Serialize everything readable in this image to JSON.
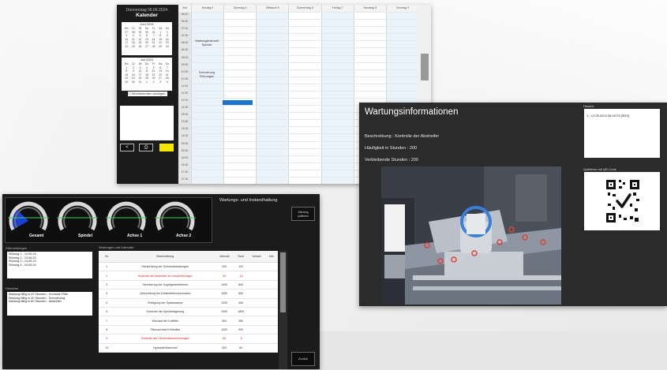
{
  "calendar": {
    "weekday_line": "Donnerstag 06.06.2024",
    "title": "Kalender",
    "months": [
      {
        "name": "Juni 2024",
        "days": [
          "Mo",
          "Di",
          "Mi",
          "Do",
          "Fr",
          "Sa",
          "So",
          "27",
          "28",
          "29",
          "30",
          "31",
          "1",
          "2",
          "3",
          "4",
          "5",
          "6",
          "7",
          "8",
          "9",
          "10",
          "11",
          "12",
          "13",
          "14",
          "15",
          "16",
          "17",
          "18",
          "19",
          "20",
          "21",
          "22",
          "23",
          "24",
          "25",
          "26",
          "27",
          "28",
          "29",
          "30"
        ]
      },
      {
        "name": "Juli 2024",
        "days": [
          "Mo",
          "Di",
          "Mi",
          "Do",
          "Fr",
          "Sa",
          "So",
          "1",
          "2",
          "3",
          "4",
          "5",
          "6",
          "7",
          "8",
          "9",
          "10",
          "11",
          "12",
          "13",
          "14",
          "15",
          "16",
          "17",
          "18",
          "19",
          "20",
          "21",
          "22",
          "23",
          "24",
          "25",
          "26",
          "27",
          "28",
          "29",
          "30",
          "31",
          "1",
          "2",
          "3",
          "4"
        ]
      }
    ],
    "checkbox_label": "Wochenenden anzeigen",
    "buttons": [
      "<",
      "⎙",
      ""
    ],
    "time_header": "Zeit",
    "day_headers": [
      "Montag 3",
      "Dienstag 4",
      "Mittwoch 5",
      "Donnerstag 6",
      "Freitag 7",
      "Samstag 8",
      "Sonntag 9"
    ],
    "times": [
      "06:00",
      "06:30",
      "07:00",
      "07:30",
      "08:00",
      "08:30",
      "09:00",
      "09:30",
      "10:00",
      "10:30",
      "11:00",
      "11:30",
      "12:00",
      "12:30",
      "13:00",
      "13:30",
      "14:00",
      "14:30",
      "15:00",
      "15:30",
      "16:00",
      "16:30",
      "17:00",
      "17:30"
    ],
    "events": [
      "Wartungsintervall Spindel",
      "Schmierung Führungen"
    ]
  },
  "maintenance": {
    "title": "Wartungsinformationen",
    "lines": [
      "Beschreibung : Kontrolle der Abstreifer",
      "Häufigkeit in Stunden : 200",
      "Verbleibende Stunden : 200"
    ],
    "history_label": "Historie",
    "history_entry": "1 - 12.06.2024 08:40:23 [SDS]",
    "qr_label": "Quittieren mit QR-Code"
  },
  "counters": {
    "gauges": [
      "Gesamt",
      "Spindel",
      "Achse 1",
      "Achse 2"
    ],
    "title": "Wartungs- und Instandhaltung",
    "top_button": "Wartung quittieren",
    "messages_label": "Störmeldungen",
    "messages": [
      "Störung 1 - 12.06.24",
      "Störung 2 - 13.06.24",
      "Störung 3 - 14.06.24",
      "Störung 4 - 15.06.24"
    ],
    "info_label": "Hinweise",
    "info": [
      "Wartung fällig in 20 Stunden - Kontrolle Filter",
      "Wartung fällig in 40 Stunden - Schmierung",
      "Wartung fällig in 80 Stunden - Abstreifer"
    ],
    "table_title": "Wartungen und Intervalle",
    "columns": [
      "Nr.",
      "Beschreibung",
      "Intervall",
      "Rest",
      "Verlauf",
      "Info"
    ],
    "rows": [
      {
        "nr": "1",
        "desc": "Sichtprüfung der Schutzabdeckungen",
        "interval": "200",
        "rest": "120",
        "red": false
      },
      {
        "nr": "2",
        "desc": "Kontrolle der Abstreifer an Linearführungen",
        "interval": "50",
        "rest": "-10",
        "red": true
      },
      {
        "nr": "3",
        "desc": "Schmierung der Kugelgewindetriebe",
        "interval": "1000",
        "rest": "840",
        "red": false
      },
      {
        "nr": "4",
        "desc": "Überprüfung der Kühlmittelkonzentration",
        "interval": "1000",
        "rest": "650",
        "red": false
      },
      {
        "nr": "5",
        "desc": "Reinigung der Spänewanne",
        "interval": "1000",
        "rest": "460",
        "red": false
      },
      {
        "nr": "6",
        "desc": "Kontrolle der Spindellagerung",
        "interval": "2000",
        "rest": "1800",
        "red": false
      },
      {
        "nr": "7",
        "desc": "Wechsel der Luftfilter",
        "interval": "500",
        "rest": "380",
        "red": false
      },
      {
        "nr": "8",
        "desc": "Filterwechsel Kühlmittel",
        "interval": "1000",
        "rest": "900",
        "red": false
      },
      {
        "nr": "9",
        "desc": "Kontrolle der Sicherheitseinrichtungen",
        "interval": "50",
        "rest": "-5",
        "red": true
      },
      {
        "nr": "10",
        "desc": "Hydraulikölwechsel",
        "interval": "300",
        "rest": "60",
        "red": false
      }
    ],
    "close_button": "Zurück"
  },
  "colors": {
    "accent_blue": "#1e73c8",
    "yellow": "#f5e800",
    "alert_red": "#d62020",
    "gauge_blue": "#1a3fd6",
    "gauge_line": "#3fd05a"
  }
}
